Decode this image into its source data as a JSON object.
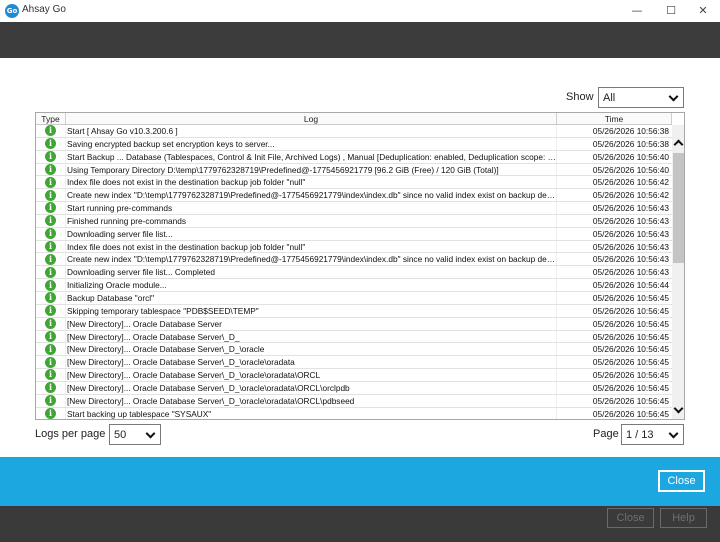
{
  "window": {
    "title": "Ahsay Go",
    "app_icon_text": "Go",
    "minimize_glyph": "—",
    "maximize_glyph": "☐",
    "close_glyph": "✕"
  },
  "filter": {
    "show_label": "Show",
    "show_value": "All"
  },
  "table": {
    "headers": {
      "type": "Type",
      "log": "Log",
      "time": "Time"
    },
    "icon_glyph": "i",
    "icon_name": "info-icon",
    "rows": [
      {
        "log": "Start [ Ahsay Go v10.3.200.6 ]",
        "time": "05/26/2026 10:56:38"
      },
      {
        "log": "Saving encrypted backup set encryption keys to server...",
        "time": "05/26/2026 10:56:38"
      },
      {
        "log": "Start Backup ... Database (Tablespaces, Control & Init File, Archived Logs) , Manual [Deduplication: enabled, Deduplication scope: backup set, Deduplication...",
        "time": "05/26/2026 10:56:40"
      },
      {
        "log": "Using Temporary Directory D:\\temp\\1779762328719\\Predefined@-1775456921779 [96.2 GiB (Free) / 120 GiB (Total)]",
        "time": "05/26/2026 10:56:40"
      },
      {
        "log": "Index file does not exist in the destination backup job folder \"null\"",
        "time": "05/26/2026 10:56:42"
      },
      {
        "log": "Create new index \"D:\\temp\\1779762328719\\Predefined@-1775456921779\\index\\index.db\" since no valid index exist on backup destination",
        "time": "05/26/2026 10:56:42"
      },
      {
        "log": "Start running pre-commands",
        "time": "05/26/2026 10:56:43"
      },
      {
        "log": "Finished running pre-commands",
        "time": "05/26/2026 10:56:43"
      },
      {
        "log": "Downloading server file list...",
        "time": "05/26/2026 10:56:43"
      },
      {
        "log": "Index file does not exist in the destination backup job folder \"null\"",
        "time": "05/26/2026 10:56:43"
      },
      {
        "log": "Create new index \"D:\\temp\\1779762328719\\Predefined@-1775456921779\\index\\index.db\" since no valid index exist on backup destination",
        "time": "05/26/2026 10:56:43"
      },
      {
        "log": "Downloading server file list... Completed",
        "time": "05/26/2026 10:56:43"
      },
      {
        "log": "Initializing Oracle module...",
        "time": "05/26/2026 10:56:44"
      },
      {
        "log": "Backup Database \"orcl\"",
        "time": "05/26/2026 10:56:45"
      },
      {
        "log": "Skipping temporary tablespace \"PDB$SEED\\TEMP\"",
        "time": "05/26/2026 10:56:45"
      },
      {
        "log": "[New Directory]... Oracle Database Server",
        "time": "05/26/2026 10:56:45"
      },
      {
        "log": "[New Directory]... Oracle Database Server\\_D_",
        "time": "05/26/2026 10:56:45"
      },
      {
        "log": "[New Directory]... Oracle Database Server\\_D_\\oracle",
        "time": "05/26/2026 10:56:45"
      },
      {
        "log": "[New Directory]... Oracle Database Server\\_D_\\oracle\\oradata",
        "time": "05/26/2026 10:56:45"
      },
      {
        "log": "[New Directory]... Oracle Database Server\\_D_\\oracle\\oradata\\ORCL",
        "time": "05/26/2026 10:56:45"
      },
      {
        "log": "[New Directory]... Oracle Database Server\\_D_\\oracle\\oradata\\ORCL\\orclpdb",
        "time": "05/26/2026 10:56:45"
      },
      {
        "log": "[New Directory]... Oracle Database Server\\_D_\\oracle\\oradata\\ORCL\\pdbseed",
        "time": "05/26/2026 10:56:45"
      },
      {
        "log": "Start backing up tablespace \"SYSAUX\"",
        "time": "05/26/2026 10:56:45"
      }
    ]
  },
  "pagination": {
    "logs_per_page_label": "Logs per page",
    "logs_per_page_value": "50",
    "page_label": "Page",
    "page_value": "1 / 13"
  },
  "footer": {
    "close_label": "Close",
    "ghost_close_label": "Close",
    "ghost_help_label": "Help"
  },
  "colors": {
    "header_dark": "#3c3c3c",
    "footer_blue": "#1da7e1",
    "info_green": "#3fa535"
  }
}
